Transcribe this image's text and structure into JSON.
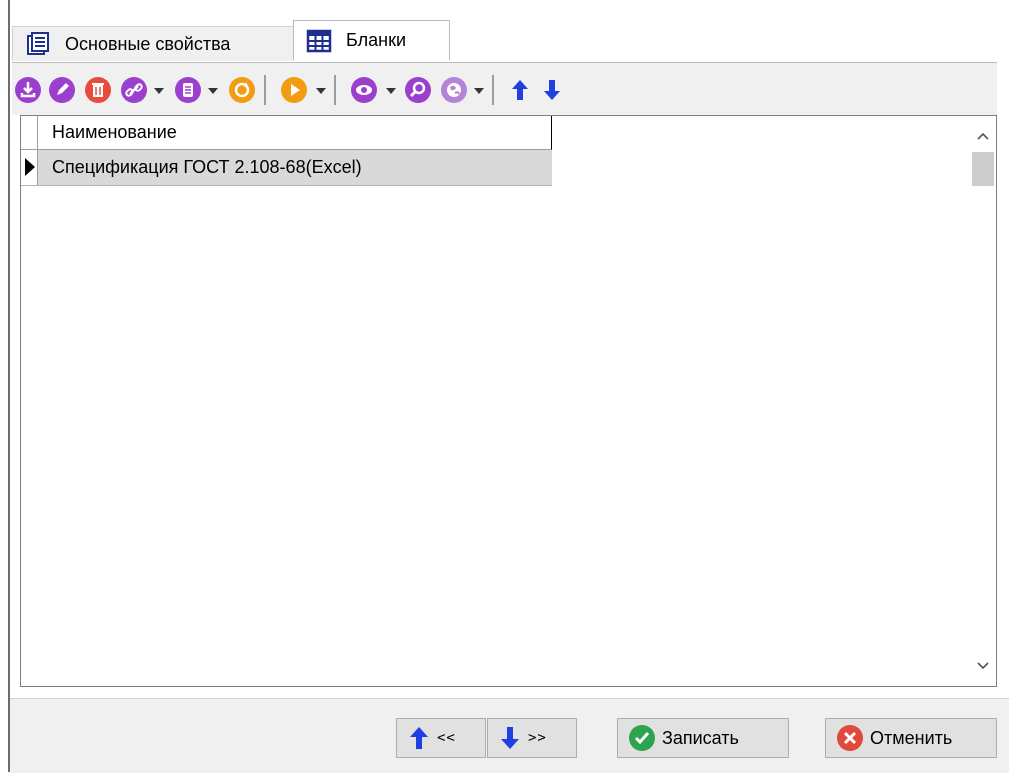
{
  "tabs": [
    {
      "label": "Основные свойства",
      "icon": "properties-doc-icon",
      "active": false
    },
    {
      "label": "Бланки",
      "icon": "table-grid-icon",
      "active": true
    }
  ],
  "toolbar": {
    "items": [
      "add-icon",
      "edit-icon",
      "delete-icon",
      "link-icon",
      "copy-icon",
      "refresh-icon",
      "run-icon",
      "view-icon",
      "search-icon",
      "web-icon",
      "move-up-icon",
      "move-down-icon"
    ],
    "colors": {
      "purple": "#9b3fcf",
      "orange": "#f39c12",
      "red": "#e74c3c",
      "blue": "#1f3fe0"
    }
  },
  "grid": {
    "columns": [
      "Наименование"
    ],
    "rows": [
      {
        "name": "Спецификация ГОСТ 2.108-68(Excel)",
        "selected": true
      }
    ]
  },
  "footer": {
    "prev_label": "<<",
    "next_label": ">>",
    "save_label": "Записать",
    "cancel_label": "Отменить",
    "save_color": "#2ea44f",
    "cancel_color": "#e04a3a"
  }
}
